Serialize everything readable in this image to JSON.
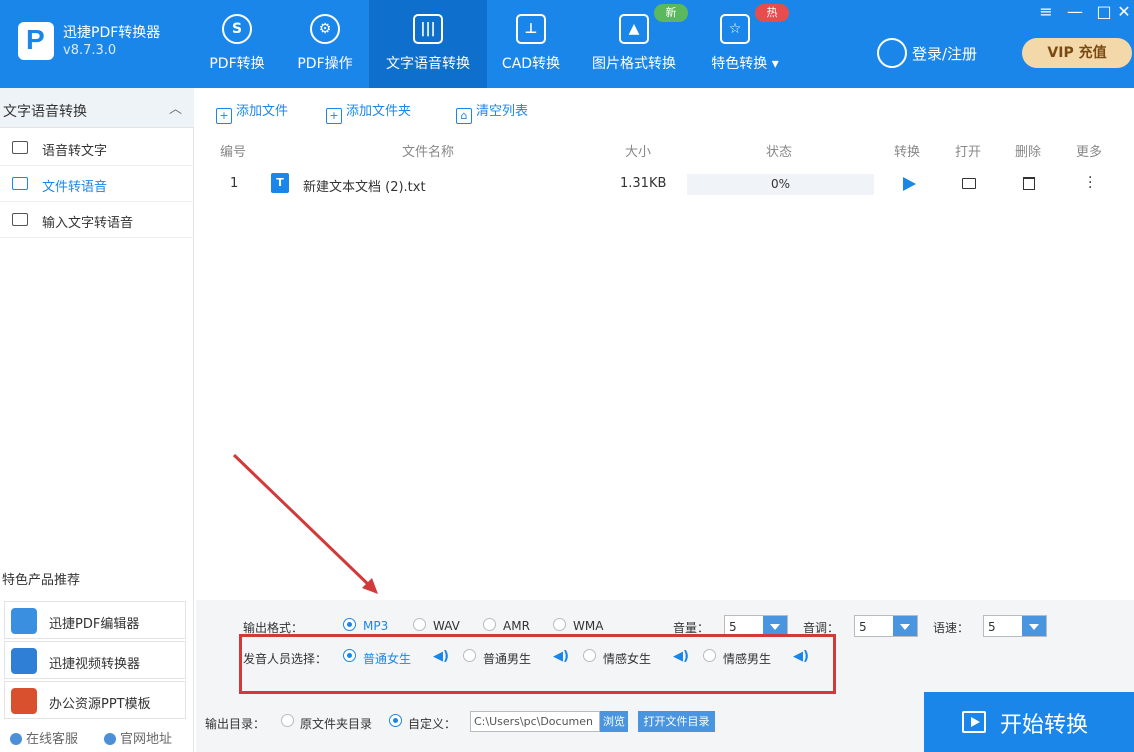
{
  "app": {
    "name": "迅捷PDF转换器",
    "version": "v8.7.3.0"
  },
  "nav": [
    {
      "label": "PDF转换",
      "icon": "refresh-s-icon"
    },
    {
      "label": "PDF操作",
      "icon": "gear-icon"
    },
    {
      "label": "文字语音转换",
      "icon": "waveform-icon"
    },
    {
      "label": "CAD转换",
      "icon": "cad-icon"
    },
    {
      "label": "图片格式转换",
      "icon": "image-icon"
    },
    {
      "label": "特色转换",
      "icon": "star-refresh-icon",
      "badge": "热"
    }
  ],
  "badges": {
    "new": "新",
    "hot": "热"
  },
  "header": {
    "login": "登录/注册",
    "vip": "VIP 充值"
  },
  "window": {
    "minimize": "—",
    "restore": "□",
    "close": "✕",
    "menu": "≡"
  },
  "sidebar": {
    "title": "文字语音转换",
    "items": [
      {
        "label": "语音转文字"
      },
      {
        "label": "文件转语音"
      },
      {
        "label": "输入文字转语音"
      }
    ],
    "promo_title": "特色产品推荐",
    "promos": [
      {
        "label": "迅捷PDF编辑器"
      },
      {
        "label": "迅捷视频转换器"
      },
      {
        "label": "办公资源PPT模板"
      }
    ],
    "footer": {
      "service": "在线客服",
      "website": "官网地址"
    }
  },
  "toolbar": {
    "add_file": "添加文件",
    "add_folder": "添加文件夹",
    "clear": "清空列表"
  },
  "table": {
    "headers": {
      "num": "编号",
      "name": "文件名称",
      "size": "大小",
      "status": "状态",
      "convert": "转换",
      "open": "打开",
      "delete": "删除",
      "more": "更多"
    },
    "rows": [
      {
        "num": "1",
        "name": "新建文本文档 (2).txt",
        "size": "1.31KB",
        "progress": "0%",
        "progress_value": 0
      }
    ]
  },
  "settings": {
    "format_label": "输出格式：",
    "formats": [
      "MP3",
      "WAV",
      "AMR",
      "WMA"
    ],
    "format_selected": "MP3",
    "volume_label": "音量：",
    "volume": "5",
    "pitch_label": "音调：",
    "pitch": "5",
    "speed_label": "语速：",
    "speed": "5",
    "voice_label": "发音人员选择：",
    "voices": [
      "普通女生",
      "普通男生",
      "情感女生",
      "情感男生"
    ],
    "voice_selected": "普通女生"
  },
  "output": {
    "label": "输出目录：",
    "option_original": "原文件夹目录",
    "option_custom": "自定义：",
    "path": "C:\\Users\\pc\\Documen",
    "browse": "浏览",
    "open_dir": "打开文件目录"
  },
  "start_button": "开始转换",
  "colors": {
    "accent": "#1b86ea",
    "annotation": "#d23a3a"
  }
}
